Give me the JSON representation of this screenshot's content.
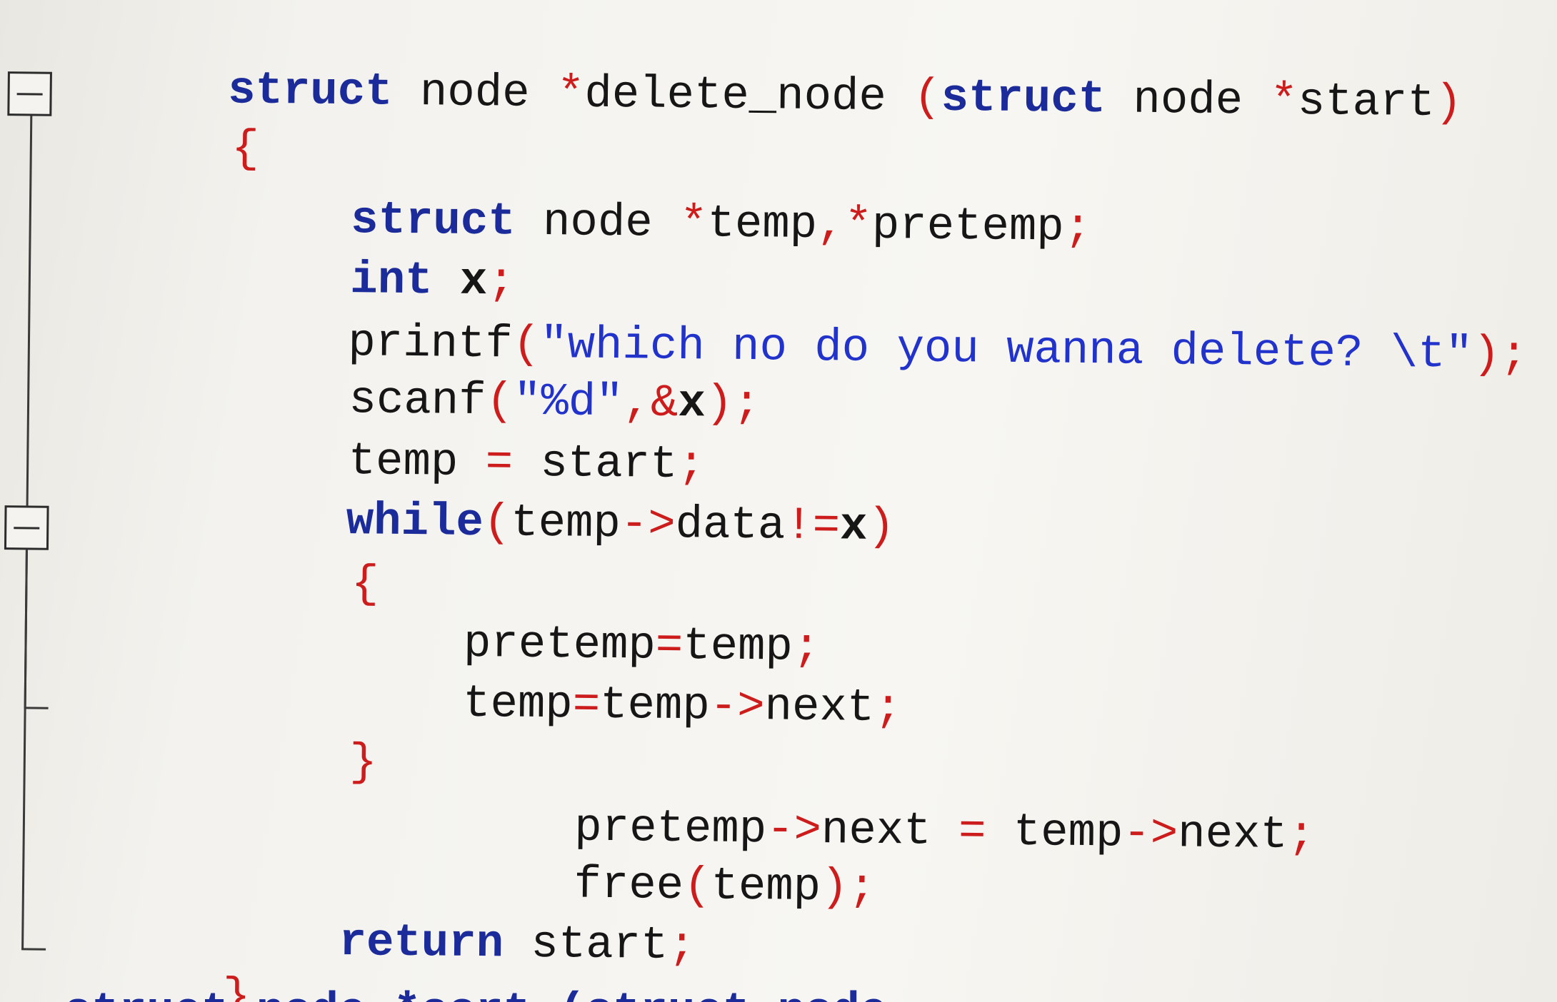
{
  "code": {
    "l1": {
      "t1": "struct",
      "t2": " node ",
      "t3": "*",
      "t4": "delete_node ",
      "t5": "(",
      "t6": "struct",
      "t7": " node ",
      "t8": "*",
      "t9": "start",
      "t10": ")"
    },
    "l2": {
      "t1": "{"
    },
    "l3": {
      "t1": "struct",
      "t2": " node ",
      "t3": "*",
      "t4": "temp",
      "t5": ",",
      "t6": "*",
      "t7": "pretemp",
      "t8": ";"
    },
    "l4": {
      "t1": "int",
      "t2": " x",
      "t3": ";"
    },
    "l5": {
      "t1": "printf",
      "t2": "(",
      "t3": "\"which no do you wanna delete? \\t\"",
      "t4": ");"
    },
    "l6": {
      "t1": "scanf",
      "t2": "(",
      "t3": "\"%d\"",
      "t4": ",&",
      "t5": "x",
      "t6": ");"
    },
    "l7": {
      "t1": "temp ",
      "t2": "=",
      "t3": " start",
      "t4": ";"
    },
    "l8": {
      "t1": "while",
      "t2": "(",
      "t3": "temp",
      "t4": "->",
      "t5": "data",
      "t6": "!=",
      "t7": "x",
      "t8": ")"
    },
    "l9": {
      "t1": "{"
    },
    "l10": {
      "t1": "pretemp",
      "t2": "=",
      "t3": "temp",
      "t4": ";"
    },
    "l11": {
      "t1": "temp",
      "t2": "=",
      "t3": "temp",
      "t4": "->",
      "t5": "next",
      "t6": ";"
    },
    "l12": {
      "t1": "}"
    },
    "l13": {
      "t1": "pretemp",
      "t2": "->",
      "t3": "next ",
      "t4": "=",
      "t5": " temp",
      "t6": "->",
      "t7": "next",
      "t8": ";"
    },
    "l14": {
      "t1": "free",
      "t2": "(",
      "t3": "temp",
      "t4": ");"
    },
    "l15": {
      "t1": "return",
      "t2": " start",
      "t3": ";"
    },
    "l16": {
      "t1": "}"
    },
    "l17": {
      "t1": "struct node *sort (struct node"
    }
  },
  "colors": {
    "keyword": "#1b2c9a",
    "string": "#2233cc",
    "punctuation": "#cc1c1c",
    "identifier": "#161616"
  },
  "icons": {
    "fold_1": "collapse-minus-icon",
    "fold_2": "collapse-minus-icon"
  }
}
